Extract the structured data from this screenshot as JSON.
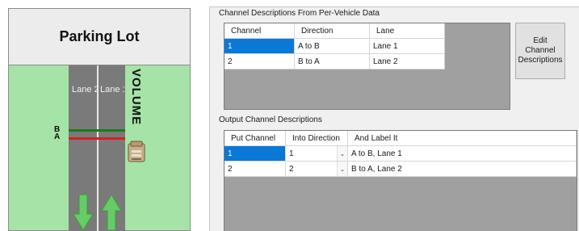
{
  "left": {
    "title": "Parking Lot",
    "lane2_label": "Lane 2",
    "lane1_label": "Lane 1",
    "volume_label": "VOLUME",
    "sensor_b_label": "B",
    "sensor_a_label": "A",
    "colors": {
      "grass": "#a6e3a6",
      "road": "#7a7a7a",
      "sensor_b": "#1b7a1b",
      "sensor_a": "#d82020",
      "arrow": "#66cc66"
    }
  },
  "channel_desc": {
    "title": "Channel Descriptions From Per-Vehicle Data",
    "headers": [
      "Channel",
      "Direction",
      "Lane"
    ],
    "rows": [
      {
        "channel": "1",
        "direction": "A to B",
        "lane": "Lane 1"
      },
      {
        "channel": "2",
        "direction": "B to A",
        "lane": "Lane 2"
      }
    ],
    "edit_button": "Edit Channel Descriptions"
  },
  "output_desc": {
    "title": "Output Channel Descriptions",
    "headers": [
      "Put Channel",
      "Into Direction",
      "And Label It"
    ],
    "rows": [
      {
        "put_channel": "1",
        "into_direction": "1",
        "label": "A to B, Lane 1"
      },
      {
        "put_channel": "2",
        "into_direction": "2",
        "label": "B to A, Lane 2"
      }
    ]
  },
  "selection_color": "#0a78d7"
}
